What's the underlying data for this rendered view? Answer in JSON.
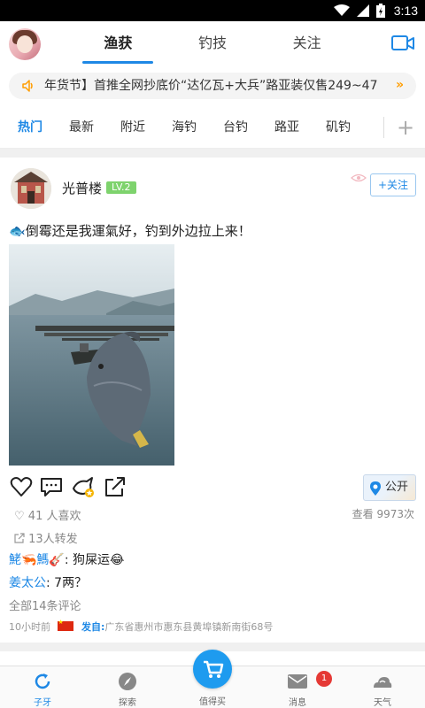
{
  "status_bar": {
    "time": "3:13"
  },
  "top_tabs": [
    {
      "label": "渔获",
      "active": true
    },
    {
      "label": "钓技",
      "active": false
    },
    {
      "label": "关注",
      "active": false
    }
  ],
  "notice": {
    "text": "年货节】首推全网抄底价“达亿瓦+大兵”路亚装仅售249~47",
    "more": "»"
  },
  "categories": [
    {
      "label": "热门",
      "active": true
    },
    {
      "label": "最新"
    },
    {
      "label": "附近"
    },
    {
      "label": "海钓"
    },
    {
      "label": "台钓"
    },
    {
      "label": "路亚"
    },
    {
      "label": "矶钓"
    }
  ],
  "categories_add": "+",
  "post": {
    "author": "光普楼",
    "level": "LV.2",
    "follow_label": "+关注",
    "text": "倒霉还是我運氣好，钓到外边拉上来！",
    "text_icon": "🐟",
    "public_label": "公开",
    "likes": "41 人喜欢",
    "views": "查看 9973次",
    "shares": "13人转发",
    "comments": [
      {
        "name": "鮱🦐鰢🎸",
        "text": ": 狗屎运😂"
      },
      {
        "name": "姜太公",
        "text": ": 7两？"
      }
    ],
    "all_comments": "全部14条评论",
    "time_ago": "10小时前",
    "from_label": "发自:",
    "location": "广东省惠州市惠东县黄埠镇新南街68号"
  },
  "bottom_nav": [
    {
      "label": "子牙",
      "active": true
    },
    {
      "label": "探索"
    },
    {
      "label": "值得买"
    },
    {
      "label": "消息",
      "badge": "1"
    },
    {
      "label": "天气"
    }
  ],
  "colors": {
    "accent": "#1e88e5",
    "level_badge": "#7ed36d",
    "notice_arrow": "#ff9d00",
    "badge": "#e53935"
  }
}
